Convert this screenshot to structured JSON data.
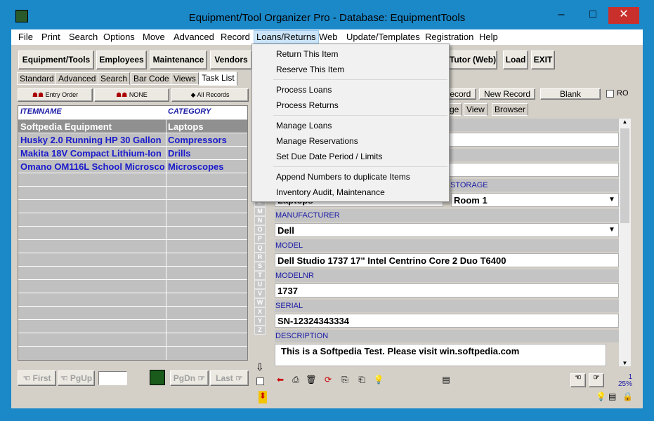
{
  "window": {
    "title": "Equipment/Tool Organizer Pro - Database: EquipmentTools",
    "controls": {
      "minimize": "–",
      "maximize": "□",
      "close": "✕"
    }
  },
  "menubar": [
    "File",
    "Print",
    "Search",
    "Options",
    "Move",
    "Advanced",
    "Record",
    "Loans/Returns",
    "Web",
    "Update/Templates",
    "Registration",
    "Help"
  ],
  "toolbar": {
    "buttons": [
      "Equipment/Tools",
      "Employees",
      "Maintenance",
      "Vendors"
    ],
    "right_buttons": [
      "Tutor (Web)",
      "Load",
      "EXIT"
    ]
  },
  "left_tabs": [
    "Standard",
    "Advanced",
    "Search",
    "Bar Code",
    "Views",
    "Task List"
  ],
  "filters": {
    "order": "Entry Order",
    "none": "NONE",
    "all": "All Records"
  },
  "grid": {
    "columns": [
      "ITEMNAME",
      "CATEGORY"
    ],
    "rows": [
      {
        "item": "Softpedia Equipment",
        "category": "Laptops"
      },
      {
        "item": "Husky 2.0 Running HP 30 Gallon",
        "category": "Compressors"
      },
      {
        "item": "Makita 18V Compact Lithium-Ion",
        "category": "Drills"
      },
      {
        "item": "Omano OM116L School Microsco",
        "category": "Microscopes"
      }
    ]
  },
  "nav": {
    "first": "First",
    "pgup": "PgUp",
    "pgdn": "PgDn",
    "last": "Last"
  },
  "letters": [
    "L",
    "M",
    "N",
    "O",
    "P",
    "Q",
    "R",
    "S",
    "T",
    "U",
    "V",
    "W",
    "X",
    "Y",
    "Z"
  ],
  "right_top": {
    "record": "Record",
    "new_record": "New Record",
    "blank": "Blank",
    "ro": "RO"
  },
  "right_tabs": [
    "ge",
    "View",
    "Browser"
  ],
  "fields": {
    "category_value": "Laptops",
    "storage_label": "STORAGE",
    "storage_value": "Room 1",
    "manufacturer_label": "MANUFACTURER",
    "manufacturer_value": "Dell",
    "model_label": "MODEL",
    "model_value": "Dell Studio 1737 17\" Intel Centrino Core 2 Duo T6400",
    "modelnr_label": "MODELNR",
    "modelnr_value": "1737",
    "serial_label": "SERIAL",
    "serial_value": "SN-12324343334",
    "description_label": "DESCRIPTION",
    "description_value": "This is a Softpedia Test. Please visit win.softpedia.com"
  },
  "record_info": {
    "count": "1",
    "zoom": "25%"
  },
  "context_menu": {
    "groups": [
      [
        "Return This Item",
        "Reserve This Item"
      ],
      [
        "Process Loans",
        "Process Returns"
      ],
      [
        "Manage Loans",
        "Manage Reservations",
        "Set Due Date Period / Limits"
      ],
      [
        "Append Numbers to duplicate Items",
        "Inventory Audit, Maintenance"
      ]
    ]
  }
}
